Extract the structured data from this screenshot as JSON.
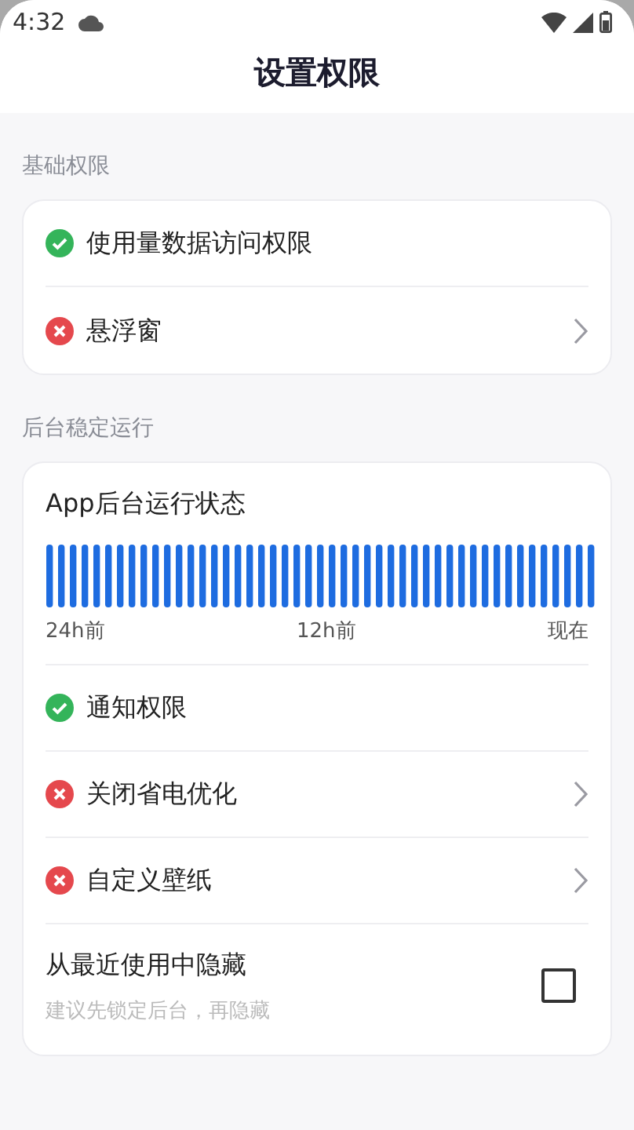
{
  "status_bar": {
    "time": "4:32"
  },
  "title": "设置权限",
  "sections": [
    {
      "label": "基础权限",
      "items": [
        {
          "kind": "permission",
          "label": "使用量数据访问权限",
          "granted": true,
          "chevron": false
        },
        {
          "kind": "permission",
          "label": "悬浮窗",
          "granted": false,
          "chevron": true
        }
      ]
    },
    {
      "label": "后台稳定运行",
      "items": [
        {
          "kind": "timeline",
          "label": "App后台运行状态",
          "axis": [
            "24h前",
            "12h前",
            "现在"
          ]
        },
        {
          "kind": "permission",
          "label": "通知权限",
          "granted": true,
          "chevron": false
        },
        {
          "kind": "permission",
          "label": "关闭省电优化",
          "granted": false,
          "chevron": true
        },
        {
          "kind": "permission",
          "label": "自定义壁纸",
          "granted": false,
          "chevron": true
        },
        {
          "kind": "checkbox",
          "label": "从最近使用中隐藏",
          "hint": "建议先锁定后台，再隐藏",
          "checked": false
        }
      ]
    }
  ]
}
